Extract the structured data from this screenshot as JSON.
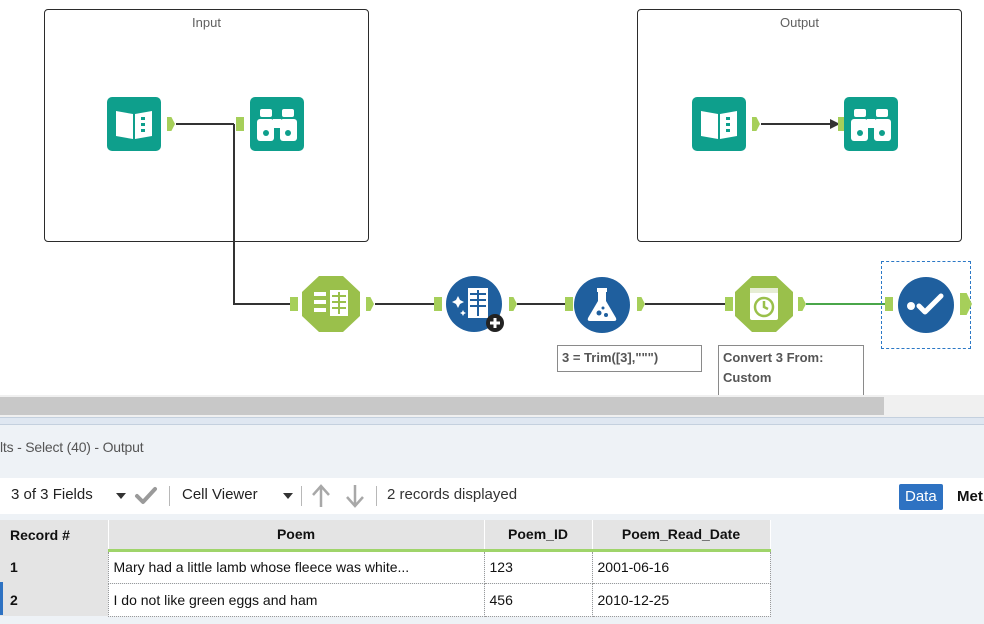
{
  "canvas": {
    "containers": {
      "input_title": "Input",
      "output_title": "Output"
    },
    "annotations": {
      "formula": "3 = Trim([3],\"\"\")",
      "datetime": "Convert 3 From: Custom"
    },
    "icons": {
      "input_reader": "input-book-icon",
      "input_browse": "browse-binoculars-icon",
      "output_reader": "output-book-icon",
      "output_browse": "output-binoculars-icon",
      "text_to_columns": "text-to-columns-icon",
      "dynamic_rename": "dynamic-rename-icon",
      "formula": "formula-flask-icon",
      "datetime": "datetime-clock-icon",
      "select": "select-check-icon"
    },
    "colors": {
      "io_teal": "#0e9f8c",
      "parse_green": "#9ac04b",
      "prep_blue": "#1f5f9e",
      "anchor": "#a6cf5a",
      "selected_wire": "#4aa64a"
    }
  },
  "results": {
    "title": "lts - Select (40) - Output",
    "toolbar": {
      "fields_label": "3 of 3 Fields",
      "viewer_label": "Cell Viewer",
      "records_label": "2 records displayed",
      "data_tab": "Data",
      "meta_tab": "Met"
    },
    "table": {
      "headers": [
        "Record #",
        "Poem",
        "Poem_ID",
        "Poem_Read_Date"
      ],
      "rows": [
        {
          "record": "1",
          "poem": "Mary had a little lamb whose fleece was white...",
          "poem_id": "123",
          "read_date": "2001-06-16"
        },
        {
          "record": "2",
          "poem": "I do not like green eggs and ham",
          "poem_id": "456",
          "read_date": "2010-12-25"
        }
      ]
    }
  }
}
